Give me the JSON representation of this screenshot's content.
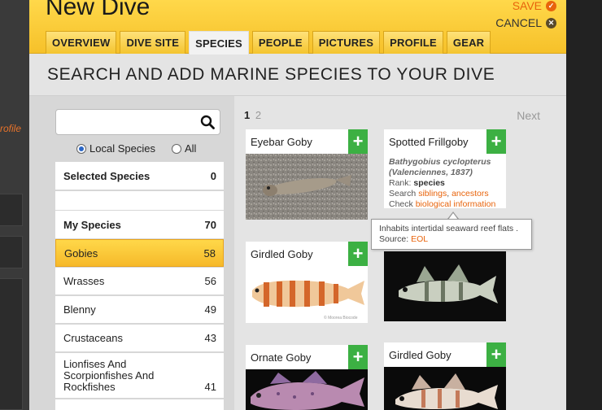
{
  "background": {
    "profile_link": "rofile"
  },
  "header": {
    "title": "New Dive",
    "save_label": "SAVE",
    "cancel_label": "CANCEL",
    "tabs": [
      {
        "label": "OVERVIEW"
      },
      {
        "label": "DIVE SITE"
      },
      {
        "label": "SPECIES"
      },
      {
        "label": "PEOPLE"
      },
      {
        "label": "PICTURES"
      },
      {
        "label": "PROFILE"
      },
      {
        "label": "GEAR"
      }
    ]
  },
  "section_title": "SEARCH AND ADD MARINE SPECIES TO YOUR DIVE",
  "search": {
    "value": "",
    "placeholder": ""
  },
  "scope": {
    "local_label": "Local Species",
    "all_label": "All",
    "selected": "local"
  },
  "selected_species": {
    "label": "Selected Species",
    "count": "0"
  },
  "my_species": {
    "label": "My Species",
    "count": "70"
  },
  "categories": [
    {
      "label": "Gobies",
      "count": "58"
    },
    {
      "label": "Wrasses",
      "count": "56"
    },
    {
      "label": "Blenny",
      "count": "49"
    },
    {
      "label": "Crustaceans",
      "count": "43"
    },
    {
      "label": "Lionfises And Scorpionfishes And Rockfishes",
      "count": "41"
    }
  ],
  "pager": {
    "current": "1",
    "other": "2",
    "next": "Next"
  },
  "cards": [
    {
      "title": "Eyebar Goby"
    },
    {
      "title": "Spotted Frillgoby"
    },
    {
      "title": "Girdled Goby"
    },
    {
      "title": "Ornate Goby"
    },
    {
      "title": "Girdled Goby"
    }
  ],
  "info_panel": {
    "latin_name": "Bathygobius cyclopterus",
    "authority": "(Valenciennes, 1837)",
    "rank_label": "Rank:",
    "rank_value": "species",
    "search_label": "Search",
    "siblings_link": "siblings",
    "comma": ",",
    "ancestors_link": "ancestors",
    "check_label": "Check",
    "bio_link": "biological information"
  },
  "tooltip": {
    "text": "Inhabits intertidal seaward reef flats .",
    "source_label": "Source:",
    "source_link": "EOL"
  },
  "image_credit": "© Moorea Biocode",
  "add_symbol": "+",
  "colors": {
    "accent": "#f6c12a",
    "add_button": "#3cb043",
    "link": "#e8640c"
  }
}
